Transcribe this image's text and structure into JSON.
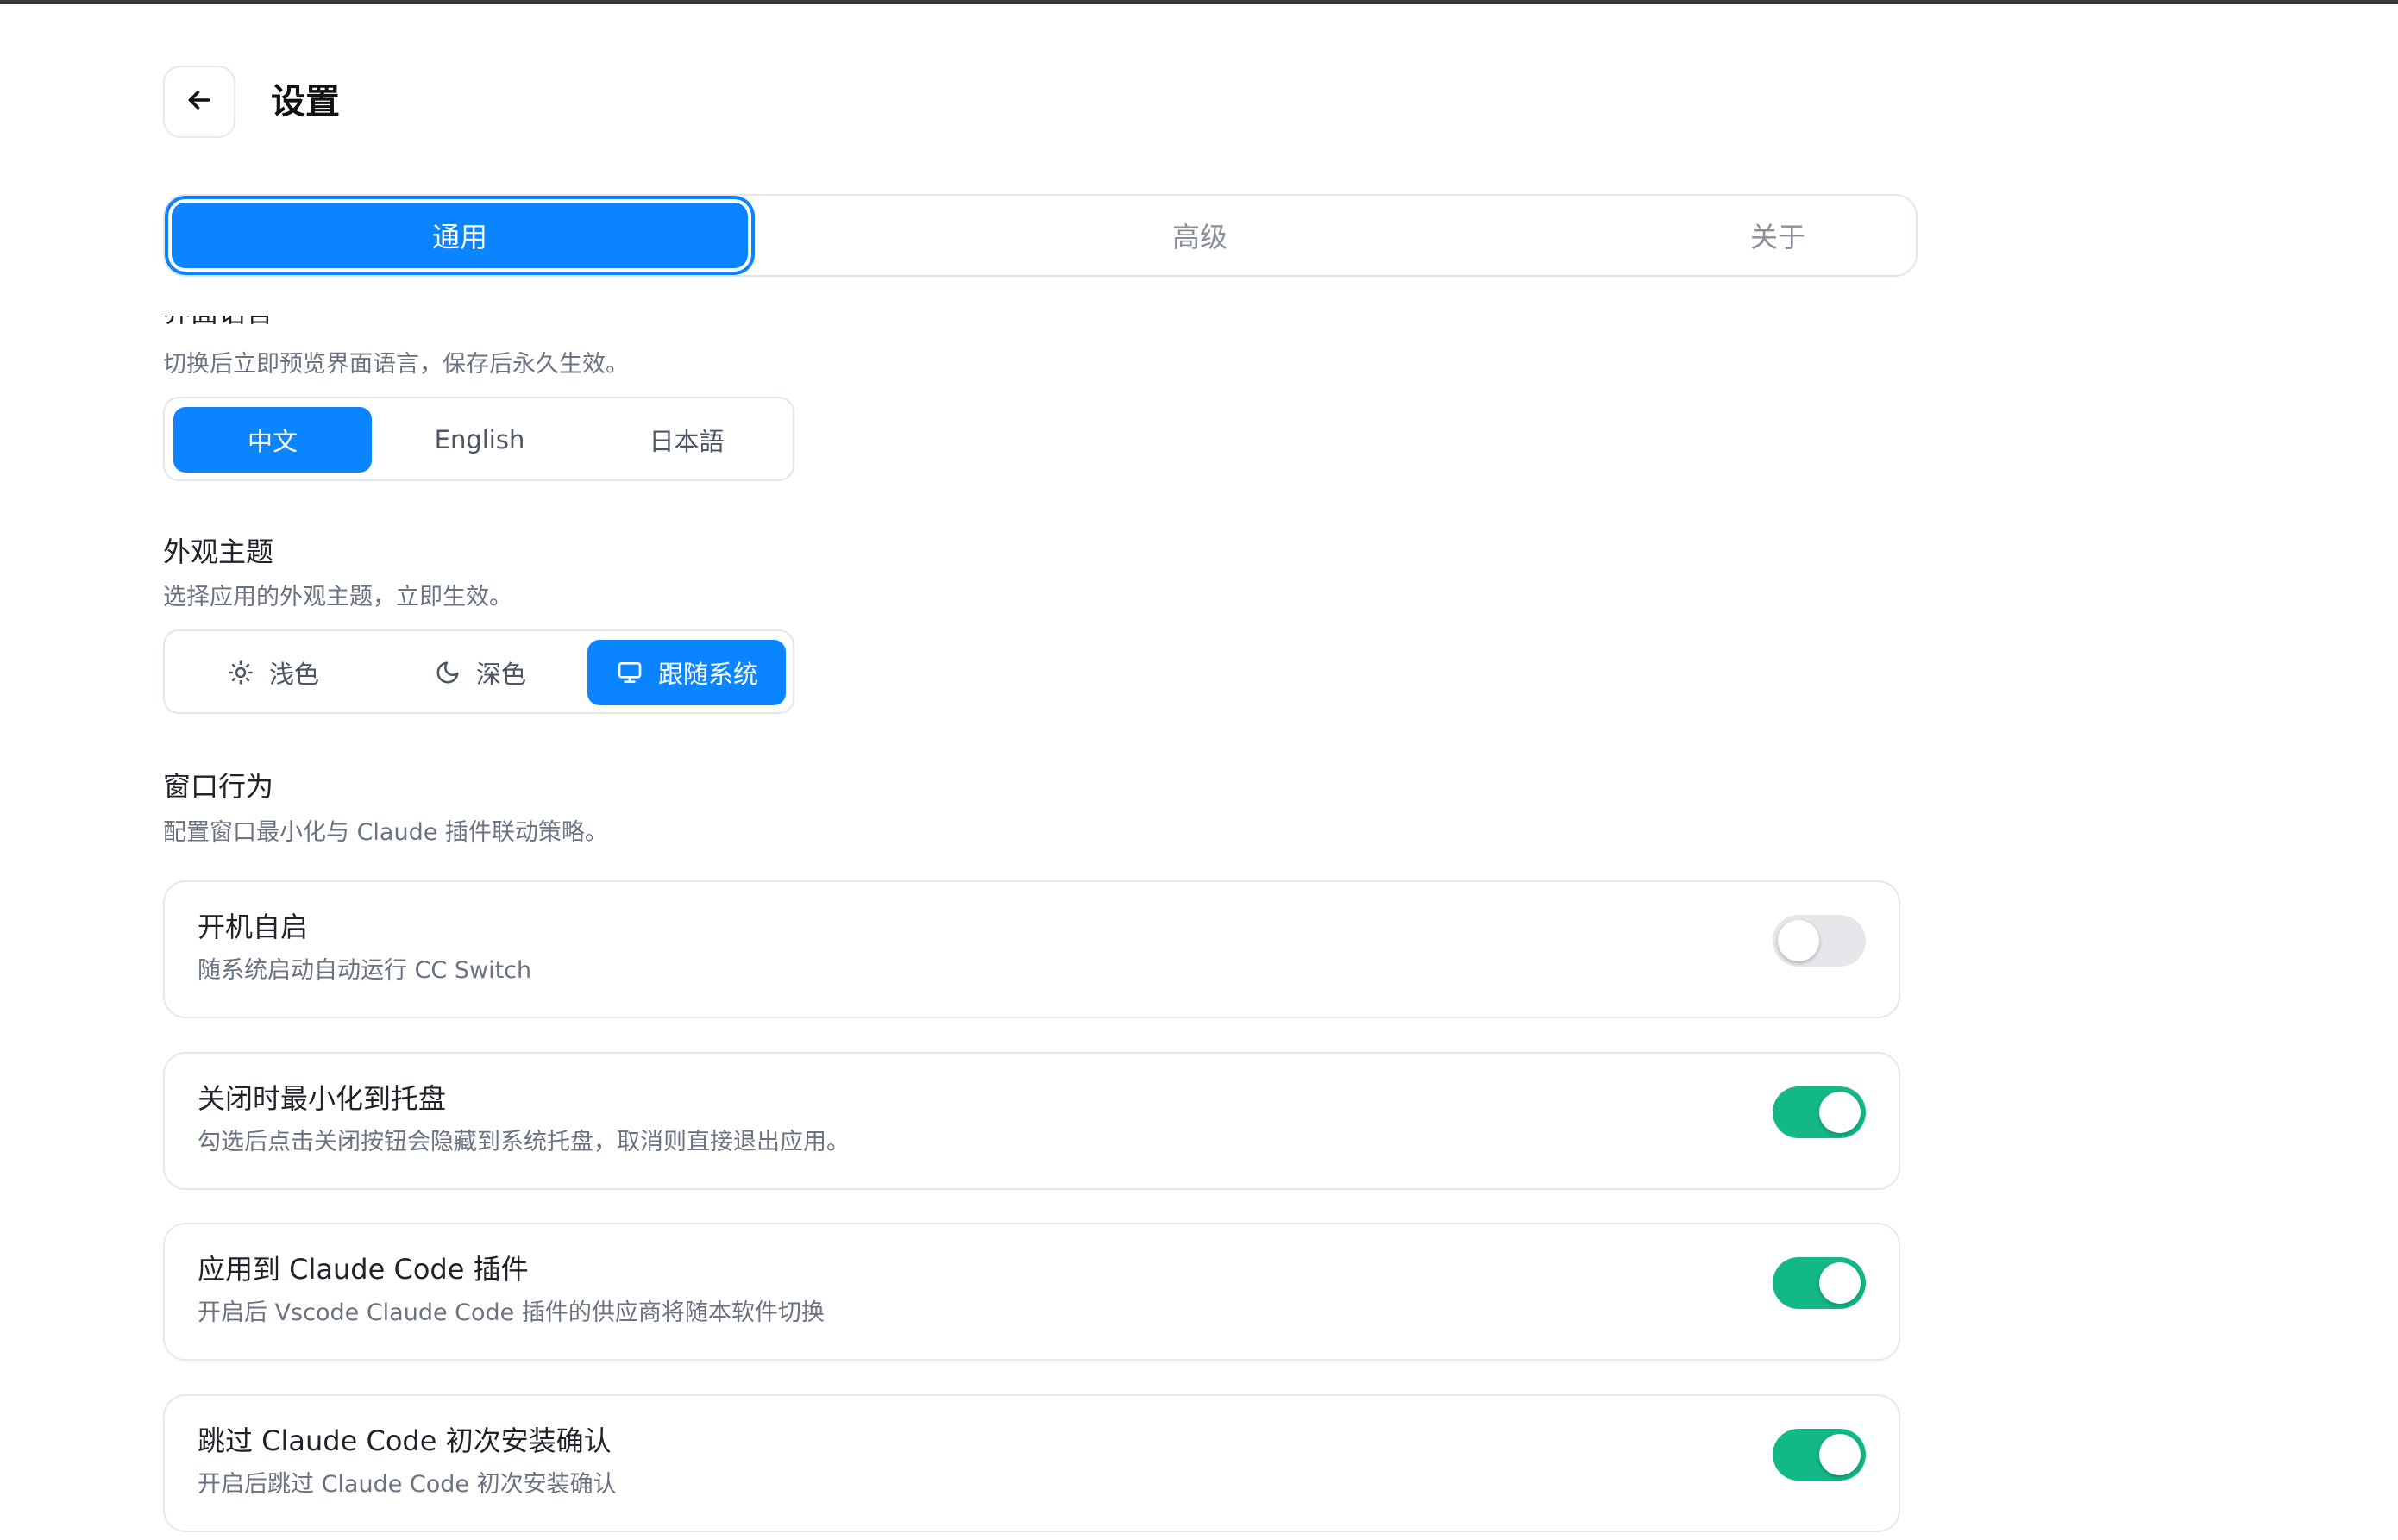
{
  "header": {
    "back_icon": "arrow-left-icon",
    "title": "设置"
  },
  "tabs": [
    {
      "label": "通用",
      "active": true
    },
    {
      "label": "高级",
      "active": false
    },
    {
      "label": "关于",
      "active": false
    }
  ],
  "language": {
    "title": "界面语言",
    "description": "切换后立即预览界面语言，保存后永久生效。",
    "options": [
      {
        "label": "中文",
        "selected": true
      },
      {
        "label": "English",
        "selected": false
      },
      {
        "label": "日本語",
        "selected": false
      }
    ]
  },
  "theme": {
    "title": "外观主题",
    "description": "选择应用的外观主题，立即生效。",
    "options": [
      {
        "label": "浅色",
        "icon": "sun-icon",
        "selected": false
      },
      {
        "label": "深色",
        "icon": "moon-icon",
        "selected": false
      },
      {
        "label": "跟随系统",
        "icon": "monitor-icon",
        "selected": true
      }
    ]
  },
  "window_behavior": {
    "title": "窗口行为",
    "description": "配置窗口最小化与 Claude 插件联动策略。",
    "items": [
      {
        "title": "开机自启",
        "description": "随系统启动自动运行 CC Switch",
        "enabled": false
      },
      {
        "title": "关闭时最小化到托盘",
        "description": "勾选后点击关闭按钮会隐藏到系统托盘，取消则直接退出应用。",
        "enabled": true
      },
      {
        "title": "应用到 Claude Code 插件",
        "description": "开启后 Vscode Claude Code 插件的供应商将随本软件切换",
        "enabled": true
      },
      {
        "title": "跳过 Claude Code 初次安装确认",
        "description": "开启后跳过 Claude Code 初次安装确认",
        "enabled": true
      }
    ]
  },
  "colors": {
    "accent": "#0a84ff",
    "toggle_on": "#12b886",
    "toggle_off": "#e5e7eb"
  }
}
